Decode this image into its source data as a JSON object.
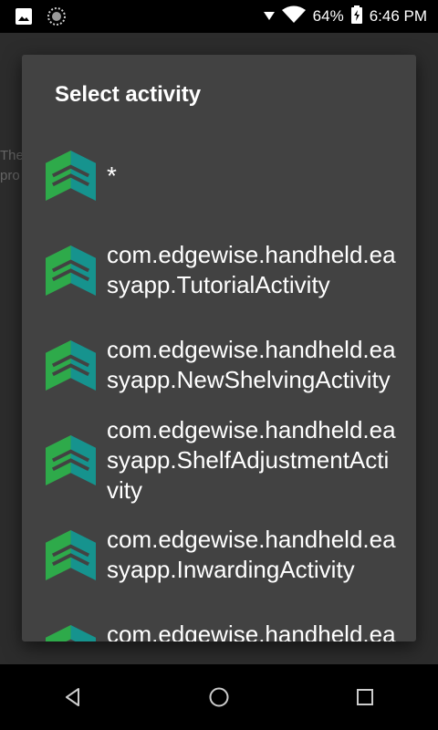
{
  "status_bar": {
    "battery": "64%",
    "time": "6:46 PM",
    "icons": [
      "image-icon",
      "settings-circle-icon",
      "signal-icon",
      "wifi-icon",
      "battery-charging-icon"
    ]
  },
  "background": {
    "text_lines": [
      "The",
      "pro"
    ]
  },
  "dialog": {
    "title": "Select activity",
    "items": [
      {
        "label": "*"
      },
      {
        "label": "com.edgewise.handheld.easyapp.TutorialActivity"
      },
      {
        "label": "com.edgewise.handheld.easyapp.NewShelvingActivity"
      },
      {
        "label": "com.edgewise.handheld.easyapp.ShelfAdjustmentActivity"
      },
      {
        "label": "com.edgewise.handheld.easyapp.InwardingActivity"
      },
      {
        "label": "com.edgewise.handheld.easyapp.PackingStation"
      }
    ]
  },
  "nav_bar": {
    "buttons": [
      "back",
      "home",
      "recents"
    ]
  },
  "colors": {
    "icon_green": "#2eaa4a",
    "icon_teal": "#16938e",
    "dialog_bg": "#424242"
  }
}
